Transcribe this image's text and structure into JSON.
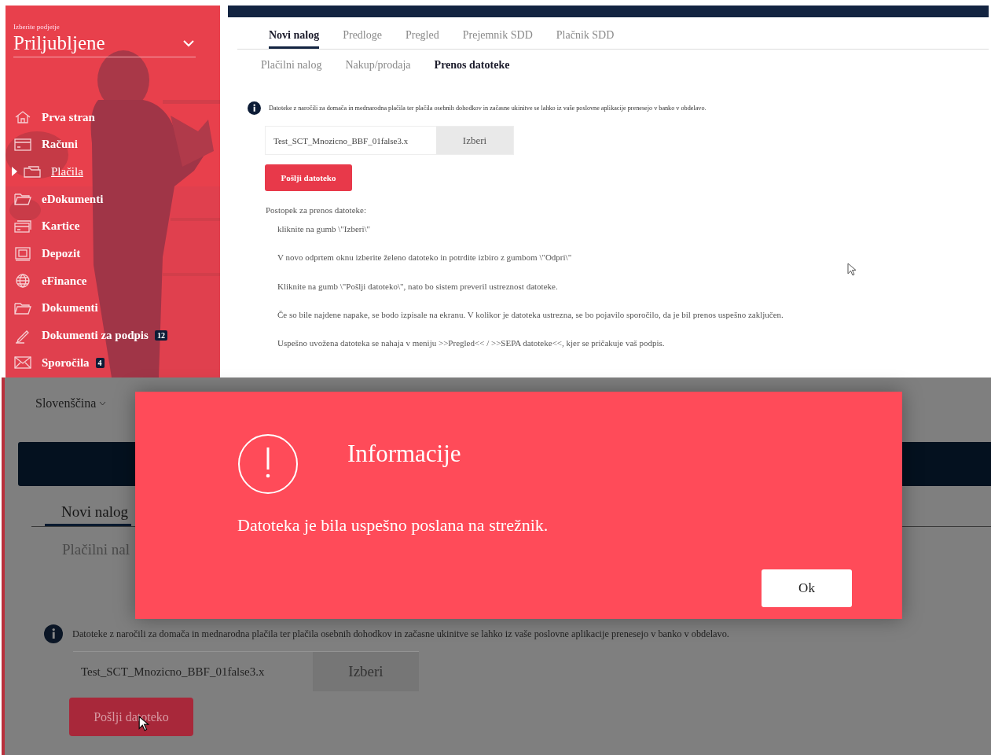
{
  "top_screen": {
    "sidebar": {
      "company_label": "Izberite podjetje",
      "company": "Priljubljene",
      "items": [
        {
          "label": "Prva stran",
          "selected": false
        },
        {
          "label": "Računi",
          "selected": false
        },
        {
          "label": "Plačila",
          "selected": true
        },
        {
          "label": "eDokumenti",
          "selected": false
        },
        {
          "label": "Kartice",
          "selected": false
        },
        {
          "label": "Depozit",
          "selected": false
        },
        {
          "label": "eFinance",
          "selected": false
        },
        {
          "label": "Dokumenti",
          "selected": false
        },
        {
          "label": "Dokumenti za podpis",
          "selected": false,
          "badge": "12"
        },
        {
          "label": "Sporočila",
          "selected": false,
          "badge": "4"
        }
      ]
    },
    "tabs": [
      {
        "label": "Novi nalog",
        "selected": true
      },
      {
        "label": "Predloge",
        "selected": false
      },
      {
        "label": "Pregled",
        "selected": false
      },
      {
        "label": "Prejemnik SDD",
        "selected": false
      },
      {
        "label": "Plačnik SDD",
        "selected": false
      }
    ],
    "subtabs": [
      {
        "label": "Plačilni nalog",
        "selected": false
      },
      {
        "label": "Nakup/prodaja",
        "selected": false
      },
      {
        "label": "Prenos datoteke",
        "selected": true
      }
    ],
    "info": "Datoteke z naročili za domača in mednarodna plačila ter plačila osebnih dohodkov in začasne ukinitve se lahko iz vaše poslovne aplikacije prenesejo v banko v obdelavo.",
    "file_value": "Test_SCT_Mnozicno_BBF_01false3.x",
    "choose_button": "Izberi",
    "send_button": "Pošlji datoteko",
    "steps_title": "Postopek za prenos datoteke:",
    "steps": [
      "kliknite na gumb \\\"Izberi\\\"",
      "V novo odprtem oknu izberite želeno datoteko in potrdite izbiro z gumbom \\\"Odpri\\\"",
      "Kliknite na gumb \\\"Pošlji datoteko\\\", nato bo sistem preveril ustreznost datoteke.",
      "Če so bile najdene napake, se bodo izpisale na ekranu. V kolikor je datoteka ustrezna, se bo pojavilo sporočilo, da je bil prenos uspešno zaključen.",
      "Uspešno uvožena datoteka se nahaja v meniju >>Pregled<< / >>SEPA datoteke<<, kjer se pričakuje vaš podpis."
    ]
  },
  "bottom_screen": {
    "language": "Slovenščina",
    "tabs": [
      {
        "label": "Novi nalog",
        "selected": true
      }
    ],
    "subtabs": [
      {
        "label": "Plačilni nal",
        "selected": false
      }
    ],
    "info": "Datoteke z naročili za domača in mednarodna plačila ter plačila osebnih dohodkov in začasne ukinitve se lahko iz vaše poslovne aplikacije prenesejo v banko v obdelavo.",
    "file_value": "Test_SCT_Mnozicno_BBF_01false3.x",
    "choose_button": "Izberi",
    "send_button": "Pošlji datoteko",
    "dialog": {
      "title": "Informacije",
      "message": "Datoteka je bila uspešno poslana na strežnik.",
      "button": "Ok"
    }
  }
}
